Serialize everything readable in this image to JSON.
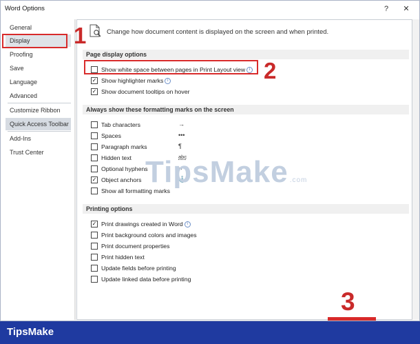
{
  "window": {
    "title": "Word Options",
    "help_icon": "?",
    "close_icon": "✕"
  },
  "sidebar": {
    "items": [
      {
        "label": "General"
      },
      {
        "label": "Display"
      },
      {
        "label": "Proofing"
      },
      {
        "label": "Save"
      },
      {
        "label": "Language"
      },
      {
        "label": "Advanced"
      },
      {
        "label": "Customize Ribbon"
      },
      {
        "label": "Quick Access Toolbar"
      },
      {
        "label": "Add-Ins"
      },
      {
        "label": "Trust Center"
      }
    ],
    "selected": "Display"
  },
  "content": {
    "intro": "Change how document content is displayed on the screen and when printed.",
    "page_display": {
      "header": "Page display options",
      "options": [
        {
          "label": "Show white space between pages in Print Layout view",
          "checked": false,
          "info": true
        },
        {
          "label": "Show highlighter marks",
          "checked": true,
          "info": true
        },
        {
          "label": "Show document tooltips on hover",
          "checked": true,
          "info": false
        }
      ]
    },
    "formatting_marks": {
      "header": "Always show these formatting marks on the screen",
      "options": [
        {
          "label": "Tab characters",
          "checked": false,
          "symbol": "→"
        },
        {
          "label": "Spaces",
          "checked": false,
          "symbol": "•••"
        },
        {
          "label": "Paragraph marks",
          "checked": false,
          "symbol": "¶"
        },
        {
          "label": "Hidden text",
          "checked": false,
          "symbol": "abc"
        },
        {
          "label": "Optional hyphens",
          "checked": false,
          "symbol": "¬"
        },
        {
          "label": "Object anchors",
          "checked": true,
          "symbol": "⚓"
        },
        {
          "label": "Show all formatting marks",
          "checked": false,
          "symbol": ""
        }
      ]
    },
    "printing": {
      "header": "Printing options",
      "options": [
        {
          "label": "Print drawings created in Word",
          "checked": true,
          "info": true
        },
        {
          "label": "Print background colors and images",
          "checked": false
        },
        {
          "label": "Print document properties",
          "checked": false
        },
        {
          "label": "Print hidden text",
          "checked": false
        },
        {
          "label": "Update fields before printing",
          "checked": false
        },
        {
          "label": "Update linked data before printing",
          "checked": false
        }
      ]
    }
  },
  "annotations": {
    "n1": "1",
    "n2": "2",
    "n3": "3"
  },
  "watermark": {
    "text": "TipsMake",
    "suffix": ".com"
  },
  "footer": {
    "brand": "TipsMake"
  },
  "colors": {
    "annotation_red": "#d82a2a",
    "footer_blue": "#1f3aa0"
  }
}
